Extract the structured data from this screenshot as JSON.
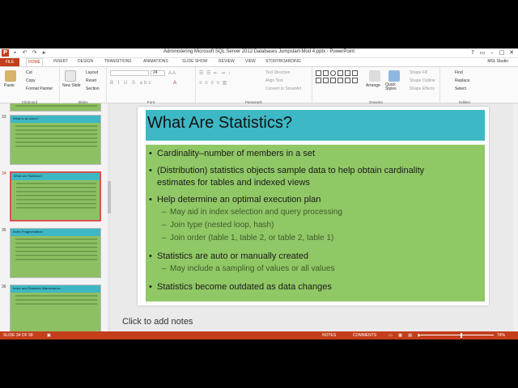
{
  "window": {
    "title": "Administering Microsoft SQL Server 2012 Databases Jumpstart-Mod 4.pptx - PowerPoint",
    "app_icon": "P",
    "controls": [
      "?",
      "▭",
      "–",
      "□",
      "✕"
    ]
  },
  "ribbon_tabs": [
    "FILE",
    "HOME",
    "INSERT",
    "DESIGN",
    "TRANSITIONS",
    "ANIMATIONS",
    "SLIDE SHOW",
    "REVIEW",
    "VIEW",
    "STORYBOARDING"
  ],
  "user": "MSL Studio",
  "ribbon": {
    "clipboard": {
      "paste": "Paste",
      "cut": "Cut",
      "copy": "Copy",
      "format_painter": "Format Painter",
      "label": "Clipboard"
    },
    "slides": {
      "new_slide": "New Slide",
      "layout": "Layout",
      "reset": "Reset",
      "section": "Section",
      "label": "Slides"
    },
    "font": {
      "size": "24",
      "label": "Font"
    },
    "paragraph": {
      "text_direction": "Text Direction",
      "align_text": "Align Text",
      "smartart": "Convert to SmartArt",
      "label": "Paragraph"
    },
    "drawing": {
      "arrange": "Arrange",
      "quick_styles": "Quick Styles",
      "shape_fill": "Shape Fill",
      "shape_outline": "Shape Outline",
      "shape_effects": "Shape Effects",
      "label": "Drawing"
    },
    "editing": {
      "find": "Find",
      "replace": "Replace",
      "select": "Select",
      "label": "Editing"
    }
  },
  "thumbnails": [
    {
      "num": "33",
      "title": "What is an index?"
    },
    {
      "num": "34",
      "title": "What are Statistics?"
    },
    {
      "num": "35",
      "title": "Index Fragmentation"
    },
    {
      "num": "36",
      "title": "Index and Statistics Maintenance"
    }
  ],
  "slide": {
    "title": "What Are Statistics?",
    "bullets": [
      {
        "text": "Cardinality–number of members in a set",
        "level": 1
      },
      {
        "text": "(Distribution) statistics objects sample data to help obtain cardinality",
        "level": 1
      },
      {
        "text": "estimates for tables and indexed views",
        "level": 1,
        "cont": true
      },
      {
        "text": "Help determine an optimal execution plan",
        "level": 1
      },
      {
        "text": "May aid in index selection and query processing",
        "level": 2
      },
      {
        "text": "Join type (nested loop, hash)",
        "level": 2
      },
      {
        "text": "Join order (table 1, table 2, or table 2, table 1)",
        "level": 2
      },
      {
        "text": "Statistics are auto or manually created",
        "level": 1
      },
      {
        "text": "May include a sampling of values or all values",
        "level": 2
      },
      {
        "text": "Statistics become outdated as data changes",
        "level": 1
      }
    ]
  },
  "notes_placeholder": "Click to add notes",
  "status": {
    "slide": "SLIDE 34 OF 58",
    "notes": "NOTES",
    "comments": "COMMENTS",
    "zoom": "74%"
  }
}
